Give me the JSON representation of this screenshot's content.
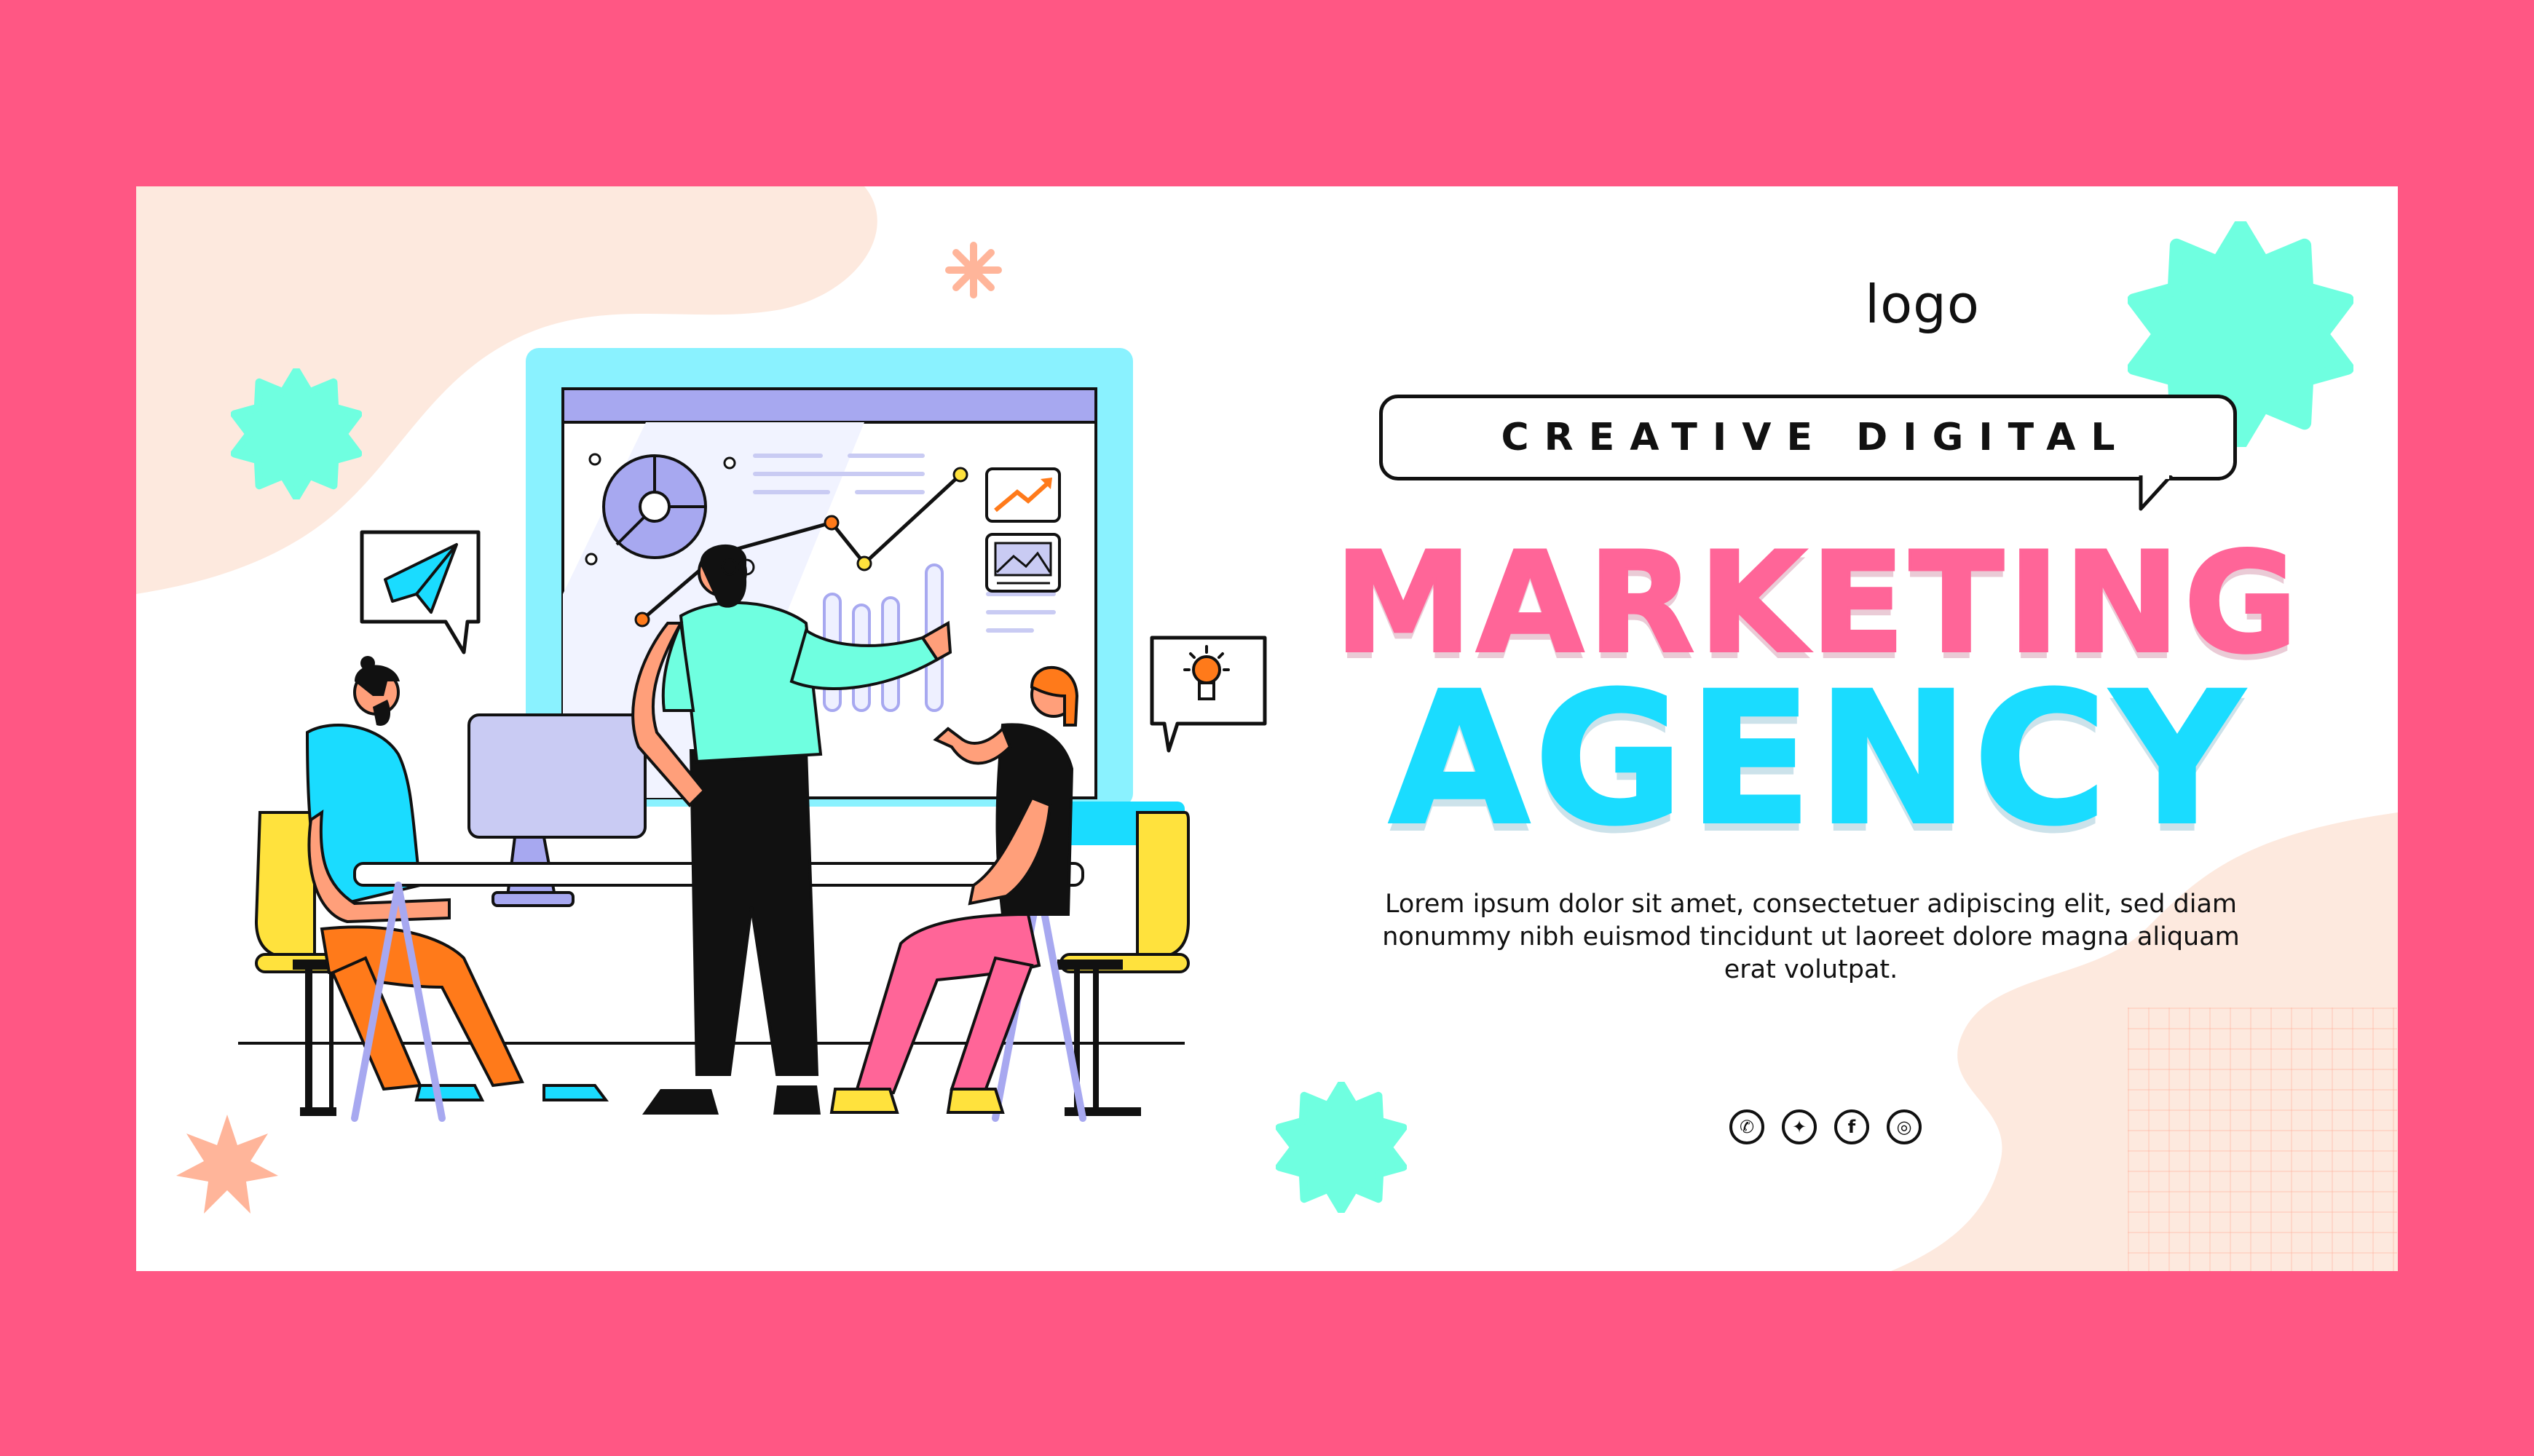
{
  "colors": {
    "frame": "#ff5784",
    "card": "#ffffff",
    "blob": "#fde9de",
    "pink": "#ff6598",
    "cyan": "#1adcff",
    "mint": "#6fffe0",
    "peach": "#ffb59a"
  },
  "brand": {
    "logo": "logo"
  },
  "hero": {
    "tagline": "CREATIVE DIGITAL",
    "line1": "MARKETING",
    "line2": "AGENCY",
    "description": "Lorem ipsum dolor sit amet, consectetuer adipiscing elit, sed diam nonummy nibh euismod tincidunt ut laoreet dolore magna aliquam erat volutpat."
  },
  "socials": [
    {
      "icon": "whatsapp-icon",
      "glyph": "✆"
    },
    {
      "icon": "twitter-icon",
      "glyph": "✦"
    },
    {
      "icon": "facebook-icon",
      "glyph": "f"
    },
    {
      "icon": "instagram-icon",
      "glyph": "◎"
    }
  ],
  "illustration": {
    "subject": "team-presentation",
    "icons": [
      "paper-plane-icon",
      "lightbulb-icon",
      "trend-up-icon",
      "image-icon",
      "pie-chart-icon"
    ]
  }
}
